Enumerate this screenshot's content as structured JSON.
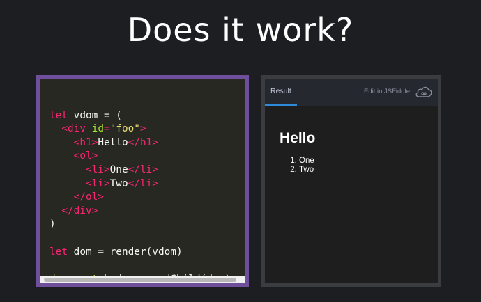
{
  "slide": {
    "title": "Does it work?"
  },
  "code_lines": [
    [],
    [
      {
        "t": "let",
        "c": "kw"
      },
      {
        "t": " vdom = (",
        "c": ""
      }
    ],
    [
      {
        "t": "  ",
        "c": ""
      },
      {
        "t": "<div",
        "c": "tag"
      },
      {
        "t": " ",
        "c": ""
      },
      {
        "t": "id",
        "c": "attr"
      },
      {
        "t": "=",
        "c": "tag"
      },
      {
        "t": "\"foo\"",
        "c": "str"
      },
      {
        "t": ">",
        "c": "tag"
      }
    ],
    [
      {
        "t": "    ",
        "c": ""
      },
      {
        "t": "<h1>",
        "c": "tag"
      },
      {
        "t": "Hello",
        "c": ""
      },
      {
        "t": "</h1>",
        "c": "tag"
      }
    ],
    [
      {
        "t": "    ",
        "c": ""
      },
      {
        "t": "<ol>",
        "c": "tag"
      }
    ],
    [
      {
        "t": "      ",
        "c": ""
      },
      {
        "t": "<li>",
        "c": "tag"
      },
      {
        "t": "One",
        "c": ""
      },
      {
        "t": "</li>",
        "c": "tag"
      }
    ],
    [
      {
        "t": "      ",
        "c": ""
      },
      {
        "t": "<li>",
        "c": "tag"
      },
      {
        "t": "Two",
        "c": ""
      },
      {
        "t": "</li>",
        "c": "tag"
      }
    ],
    [
      {
        "t": "    ",
        "c": ""
      },
      {
        "t": "</ol>",
        "c": "tag"
      }
    ],
    [
      {
        "t": "  ",
        "c": ""
      },
      {
        "t": "</div>",
        "c": "tag"
      }
    ],
    [
      {
        "t": ")",
        "c": ""
      }
    ],
    [],
    [
      {
        "t": "let",
        "c": "kw"
      },
      {
        "t": " dom = render(vdom)",
        "c": ""
      }
    ],
    [],
    [
      {
        "t": "document",
        "c": "fn"
      },
      {
        "t": ".body.appendChild(dom)",
        "c": ""
      }
    ]
  ],
  "result": {
    "tab_label": "Result",
    "edit_label": "Edit in JSFiddle",
    "heading": "Hello",
    "list_items": [
      "One",
      "Two"
    ]
  },
  "icons": {
    "cloud": "jsfiddle-cloud-icon"
  },
  "colors": {
    "background": "#1d1e22",
    "code_border": "#6f4f9c",
    "code_bg": "#272822",
    "keyword": "#f92672",
    "attribute": "#a6e22e",
    "string": "#e6db74",
    "tab_accent": "#2e8bda"
  }
}
